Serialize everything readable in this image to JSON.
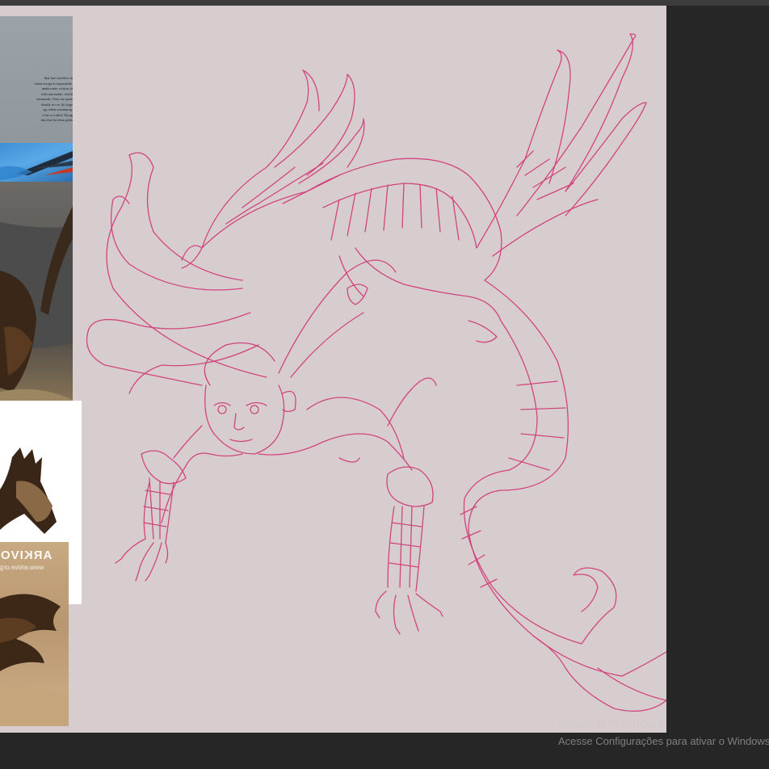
{
  "reference_text_lines": [
    "that lure travelers in",
    "when escape is impossible.",
    "underwater victims to",
    "with mermaids, which",
    "mermaids. They are quite",
    "deadly in t to fly large",
    "rgs when swimming.",
    "s the so-called 'flying",
    "fins that let them glide"
  ],
  "reference_watermark": {
    "brand": "ARKIVO",
    "url": "www.arkive.org"
  },
  "os_overlay": {
    "title": "Ativar o Windows",
    "subtitle": "Acesse Configurações para ativar o Windows."
  },
  "colors": {
    "canvas": "#d8cdce",
    "sketch_stroke": "#d0457e",
    "workspace": "#262626"
  }
}
